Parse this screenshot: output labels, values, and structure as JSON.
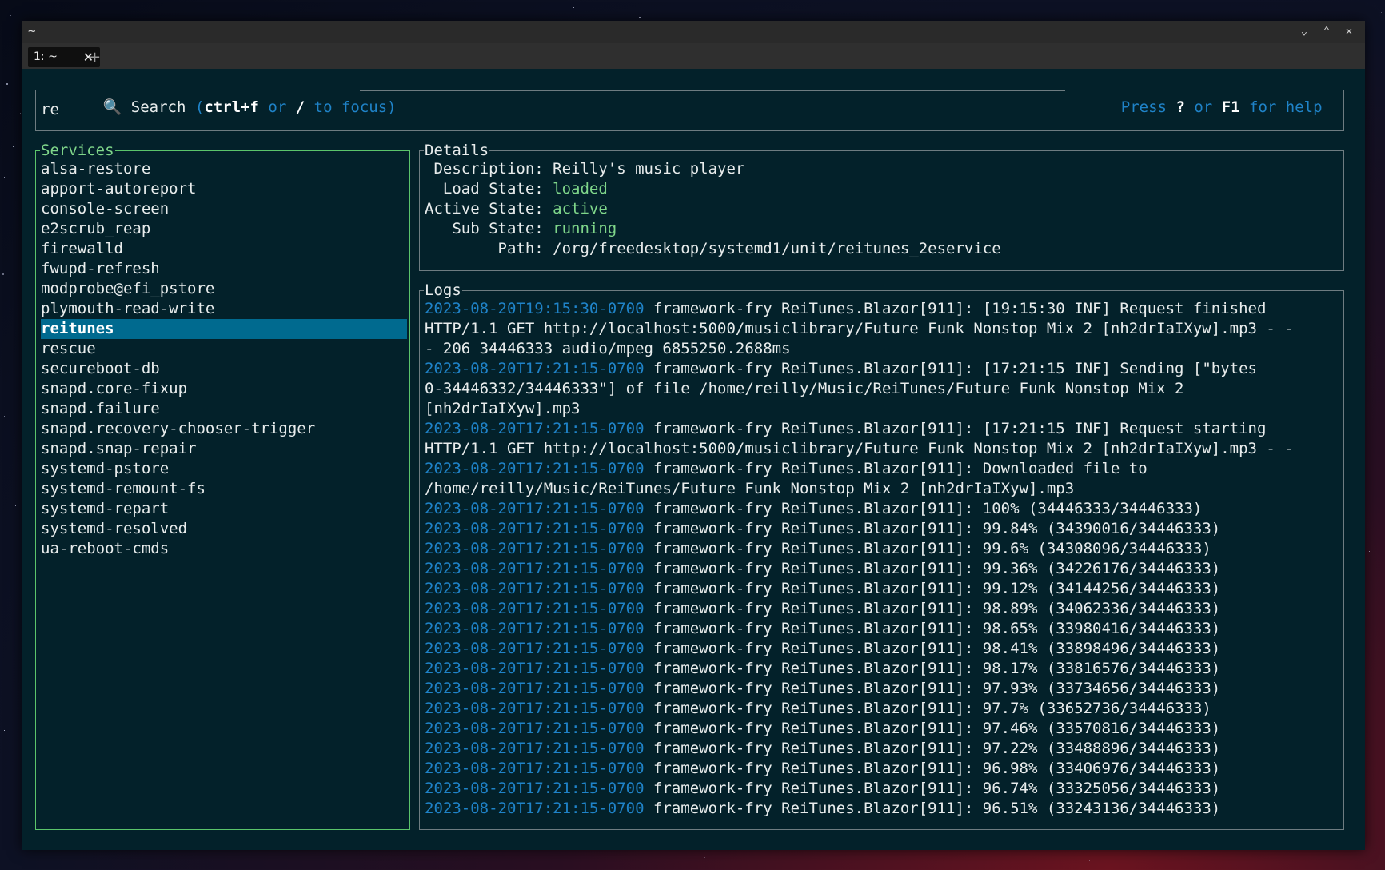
{
  "window": {
    "title": "~",
    "tab_label": "1: ~",
    "tab_close": "✕",
    "new_tab": "+",
    "controls": [
      "chevron-down-icon",
      "chevron-up-icon",
      "close-icon"
    ]
  },
  "search": {
    "label": "Search",
    "hint_open": "(",
    "hint_key1": "ctrl+f",
    "hint_or": "or",
    "hint_key2": "/",
    "hint_to_focus": "to focus)",
    "help_press": "Press",
    "help_key1": "?",
    "help_or": "or",
    "help_key2": "F1",
    "help_for_help": "for help",
    "value": "re"
  },
  "services": {
    "title": "Services",
    "selected": "reitunes",
    "items": [
      "alsa-restore",
      "apport-autoreport",
      "console-screen",
      "e2scrub_reap",
      "firewalld",
      "fwupd-refresh",
      "modprobe@efi_pstore",
      "plymouth-read-write",
      "reitunes",
      "rescue",
      "secureboot-db",
      "snapd.core-fixup",
      "snapd.failure",
      "snapd.recovery-chooser-trigger",
      "snapd.snap-repair",
      "systemd-pstore",
      "systemd-remount-fs",
      "systemd-repart",
      "systemd-resolved",
      "ua-reboot-cmds"
    ]
  },
  "details": {
    "title": "Details",
    "rows": [
      {
        "label": " Description:",
        "value": "Reilly's music player",
        "accent": false
      },
      {
        "label": "  Load State:",
        "value": "loaded",
        "accent": true
      },
      {
        "label": "Active State:",
        "value": "active",
        "accent": true
      },
      {
        "label": "   Sub State:",
        "value": "running",
        "accent": true
      },
      {
        "label": "        Path:",
        "value": "/org/freedesktop/systemd1/unit/reitunes_2eservice",
        "accent": false
      }
    ]
  },
  "logs": {
    "title": "Logs",
    "lines": [
      {
        "ts": "2023-08-20T19:15:30-0700",
        "text": " framework-fry ReiTunes.Blazor[911]: [19:15:30 INF] Request finished"
      },
      {
        "ts": "",
        "text": "HTTP/1.1 GET http://localhost:5000/musiclibrary/Future Funk Nonstop Mix 2 [nh2drIaIXyw].mp3 - -"
      },
      {
        "ts": "",
        "text": "- 206 34446333 audio/mpeg 6855250.2688ms"
      },
      {
        "ts": "2023-08-20T17:21:15-0700",
        "text": " framework-fry ReiTunes.Blazor[911]: [17:21:15 INF] Sending [\"bytes"
      },
      {
        "ts": "",
        "text": "0-34446332/34446333\"] of file /home/reilly/Music/ReiTunes/Future Funk Nonstop Mix 2"
      },
      {
        "ts": "",
        "text": "[nh2drIaIXyw].mp3"
      },
      {
        "ts": "2023-08-20T17:21:15-0700",
        "text": " framework-fry ReiTunes.Blazor[911]: [17:21:15 INF] Request starting"
      },
      {
        "ts": "",
        "text": "HTTP/1.1 GET http://localhost:5000/musiclibrary/Future Funk Nonstop Mix 2 [nh2drIaIXyw].mp3 - -"
      },
      {
        "ts": "2023-08-20T17:21:15-0700",
        "text": " framework-fry ReiTunes.Blazor[911]: Downloaded file to"
      },
      {
        "ts": "",
        "text": "/home/reilly/Music/ReiTunes/Future Funk Nonstop Mix 2 [nh2drIaIXyw].mp3"
      },
      {
        "ts": "2023-08-20T17:21:15-0700",
        "text": " framework-fry ReiTunes.Blazor[911]: 100% (34446333/34446333)"
      },
      {
        "ts": "2023-08-20T17:21:15-0700",
        "text": " framework-fry ReiTunes.Blazor[911]: 99.84% (34390016/34446333)"
      },
      {
        "ts": "2023-08-20T17:21:15-0700",
        "text": " framework-fry ReiTunes.Blazor[911]: 99.6% (34308096/34446333)"
      },
      {
        "ts": "2023-08-20T17:21:15-0700",
        "text": " framework-fry ReiTunes.Blazor[911]: 99.36% (34226176/34446333)"
      },
      {
        "ts": "2023-08-20T17:21:15-0700",
        "text": " framework-fry ReiTunes.Blazor[911]: 99.12% (34144256/34446333)"
      },
      {
        "ts": "2023-08-20T17:21:15-0700",
        "text": " framework-fry ReiTunes.Blazor[911]: 98.89% (34062336/34446333)"
      },
      {
        "ts": "2023-08-20T17:21:15-0700",
        "text": " framework-fry ReiTunes.Blazor[911]: 98.65% (33980416/34446333)"
      },
      {
        "ts": "2023-08-20T17:21:15-0700",
        "text": " framework-fry ReiTunes.Blazor[911]: 98.41% (33898496/34446333)"
      },
      {
        "ts": "2023-08-20T17:21:15-0700",
        "text": " framework-fry ReiTunes.Blazor[911]: 98.17% (33816576/34446333)"
      },
      {
        "ts": "2023-08-20T17:21:15-0700",
        "text": " framework-fry ReiTunes.Blazor[911]: 97.93% (33734656/34446333)"
      },
      {
        "ts": "2023-08-20T17:21:15-0700",
        "text": " framework-fry ReiTunes.Blazor[911]: 97.7% (33652736/34446333)"
      },
      {
        "ts": "2023-08-20T17:21:15-0700",
        "text": " framework-fry ReiTunes.Blazor[911]: 97.46% (33570816/34446333)"
      },
      {
        "ts": "2023-08-20T17:21:15-0700",
        "text": " framework-fry ReiTunes.Blazor[911]: 97.22% (33488896/34446333)"
      },
      {
        "ts": "2023-08-20T17:21:15-0700",
        "text": " framework-fry ReiTunes.Blazor[911]: 96.98% (33406976/34446333)"
      },
      {
        "ts": "2023-08-20T17:21:15-0700",
        "text": " framework-fry ReiTunes.Blazor[911]: 96.74% (33325056/34446333)"
      },
      {
        "ts": "2023-08-20T17:21:15-0700",
        "text": " framework-fry ReiTunes.Blazor[911]: 96.51% (33243136/34446333)"
      }
    ]
  },
  "colors": {
    "background": "#03212a",
    "services_border": "#5bc46b",
    "selected_bg": "#006a8f",
    "timestamp": "#1f83c8",
    "state_green": "#7fd68a"
  }
}
